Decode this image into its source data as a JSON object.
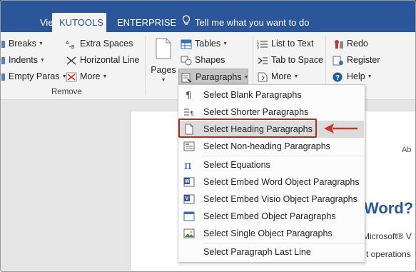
{
  "tabs": [
    {
      "label": "View"
    },
    {
      "label": "KUTOOLS"
    },
    {
      "label": "ENTERPRISE"
    }
  ],
  "tell_me": "Tell me what you want to do",
  "ribbon": {
    "remove_group": {
      "label": "Remove",
      "breaks": "Breaks",
      "indents": "Indents",
      "empty_paras": "Empty Paras",
      "extra_spaces": "Extra Spaces",
      "horizontal_line": "Horizontal Line",
      "more": "More"
    },
    "pages": "Pages",
    "tables": "Tables",
    "shapes": "Shapes",
    "paragraphs": "Paragraphs",
    "list_to_text": "List to Text",
    "tab_to_space": "Tab to Space",
    "more2": "More",
    "redo": "Redo",
    "register": "Register",
    "help": "Help"
  },
  "menu": {
    "items": [
      {
        "label": "Select Blank Paragraphs",
        "icon": "pilcrow-icon"
      },
      {
        "label": "Select Shorter Paragraphs",
        "icon": "short-para-icon"
      },
      {
        "label": "Select Heading Paragraphs",
        "icon": "heading-page-icon"
      },
      {
        "label": "Select Non-heading Paragraphs",
        "icon": "non-heading-icon"
      },
      {
        "label": "Select Equations",
        "icon": "pi-icon"
      },
      {
        "label": "Select Embed Word Object Paragraphs",
        "icon": "word-object-icon"
      },
      {
        "label": "Select Embed Visio Object Paragraphs",
        "icon": "visio-object-icon"
      },
      {
        "label": "Select Embed Object Paragraphs",
        "icon": "embed-object-icon"
      },
      {
        "label": "Select Single Object Paragraphs",
        "icon": "picture-icon"
      },
      {
        "label": "Select Paragraph Last Line",
        "icon": "none"
      }
    ]
  },
  "document": {
    "text1": "Ab",
    "text2": "Word?",
    "text3": "Microsoft® V",
    "text4": "t operations"
  },
  "colors": {
    "accent": "#2b579a",
    "highlight_border": "#a0341f",
    "arrow": "#c0392b"
  }
}
